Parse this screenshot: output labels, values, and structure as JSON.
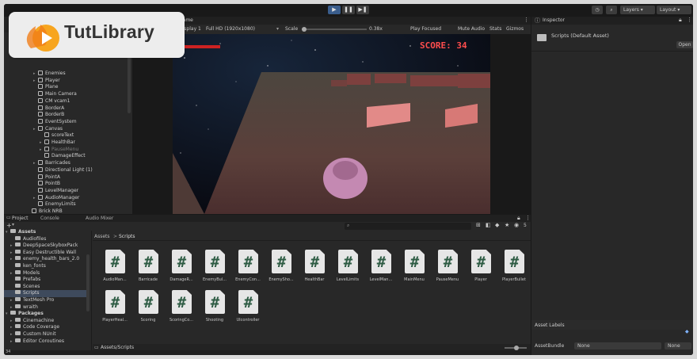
{
  "watermark": {
    "brand": "TutLibrary"
  },
  "toolbar": {
    "layers": "Layers",
    "layout": "Layout"
  },
  "hierarchy": {
    "items": [
      {
        "label": "Enemies",
        "indent": 1,
        "arrow": true
      },
      {
        "label": "Player",
        "indent": 1,
        "arrow": true
      },
      {
        "label": "Plane",
        "indent": 1,
        "arrow": false
      },
      {
        "label": "Main Camera",
        "indent": 1,
        "arrow": false
      },
      {
        "label": "CM vcam1",
        "indent": 1,
        "arrow": false
      },
      {
        "label": "BorderA",
        "indent": 1,
        "arrow": false
      },
      {
        "label": "BorderB",
        "indent": 1,
        "arrow": false
      },
      {
        "label": "EventSystem",
        "indent": 1,
        "arrow": false
      },
      {
        "label": "Canvas",
        "indent": 1,
        "arrow": true
      },
      {
        "label": "scoreText",
        "indent": 2,
        "arrow": false
      },
      {
        "label": "HealthBar",
        "indent": 2,
        "arrow": true
      },
      {
        "label": "PauseMenu",
        "indent": 2,
        "arrow": true,
        "dim": true
      },
      {
        "label": "DamageEffect",
        "indent": 2,
        "arrow": false
      },
      {
        "label": "Barricades",
        "indent": 1,
        "arrow": true
      },
      {
        "label": "Directional Light (1)",
        "indent": 1,
        "arrow": false
      },
      {
        "label": "PointA",
        "indent": 1,
        "arrow": false
      },
      {
        "label": "PointB",
        "indent": 1,
        "arrow": false
      },
      {
        "label": "LevelManager",
        "indent": 1,
        "arrow": false
      },
      {
        "label": "AudioManager",
        "indent": 1,
        "arrow": true
      },
      {
        "label": "EnemyLimits",
        "indent": 1,
        "arrow": false
      },
      {
        "label": "Brick NRB",
        "indent": 0,
        "arrow": false
      },
      {
        "label": "Brick NRB",
        "indent": 0,
        "arrow": false
      },
      {
        "label": "Brick NRB",
        "indent": 0,
        "arrow": false
      }
    ]
  },
  "game": {
    "tab": "Game",
    "display": "Display 1",
    "resolution": "Full HD (1920x1080)",
    "scale_label": "Scale",
    "scale_value": "0.38x",
    "play_focused": "Play Focused",
    "mute": "Mute Audio",
    "stats": "Stats",
    "gizmos": "Gizmos",
    "score": "SCORE: 34"
  },
  "inspector": {
    "tab": "Inspector",
    "asset_title": "Scripts (Default Asset)",
    "open": "Open",
    "asset_labels": "Asset Labels",
    "asset_bundle": "AssetBundle",
    "bundle_value": "None",
    "variant_value": "None"
  },
  "bottom": {
    "tabs": [
      "Project",
      "Console",
      "Audio Mixer"
    ],
    "breadcrumb_root": "Assets",
    "breadcrumb_sep": ">",
    "breadcrumb_current": "Scripts",
    "footer_path": "Assets/Scripts",
    "count_badge": "5",
    "status_count": "34"
  },
  "project_tree": [
    {
      "label": "Assets",
      "indent": 0,
      "bold": true,
      "arrow": "▾"
    },
    {
      "label": "Audiofiles",
      "indent": 1
    },
    {
      "label": "DeepSpaceSkyboxPack",
      "indent": 1,
      "arrow": "▸"
    },
    {
      "label": "Easy Destructible Wall",
      "indent": 1,
      "arrow": "▸"
    },
    {
      "label": "enemy_health_bars_2.0",
      "indent": 1,
      "arrow": "▸"
    },
    {
      "label": "ken_fonts",
      "indent": 1
    },
    {
      "label": "Models",
      "indent": 1,
      "arrow": "▸"
    },
    {
      "label": "Prefabs",
      "indent": 1
    },
    {
      "label": "Scenes",
      "indent": 1
    },
    {
      "label": "Scripts",
      "indent": 1,
      "selected": true
    },
    {
      "label": "TextMesh Pro",
      "indent": 1,
      "arrow": "▸"
    },
    {
      "label": "wraith",
      "indent": 1,
      "arrow": "▸"
    },
    {
      "label": "Packages",
      "indent": 0,
      "bold": true,
      "arrow": "▾"
    },
    {
      "label": "Cinemachine",
      "indent": 1,
      "arrow": "▸"
    },
    {
      "label": "Code Coverage",
      "indent": 1,
      "arrow": "▸"
    },
    {
      "label": "Custom NUnit",
      "indent": 1,
      "arrow": "▸"
    },
    {
      "label": "Editor Coroutines",
      "indent": 1,
      "arrow": "▸"
    }
  ],
  "scripts": [
    "AudioMan...",
    "Barricade",
    "DamageR...",
    "EnemyBul...",
    "EnemyCon...",
    "EnemySho...",
    "HealthBar",
    "LevelLimits",
    "LevelMan...",
    "MainMenu",
    "PauseMenu",
    "Player",
    "PlayerBullet",
    "PlayerHeal...",
    "Scoring",
    "ScoringCo...",
    "Shooting",
    "UIcontroller"
  ]
}
